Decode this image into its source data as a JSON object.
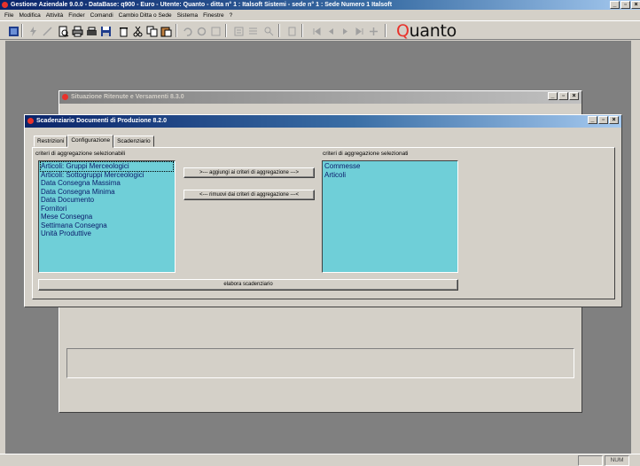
{
  "app": {
    "title": "Gestione Aziendale 9.0.0 - DataBase: q900 - Euro - Utente: Quanto - ditta n° 1 : Italsoft Sistemi - sede n° 1 : Sede Numero 1 Italsoft",
    "brand_prefix": "Q",
    "brand_rest": "uanto"
  },
  "menu": [
    "File",
    "Modifica",
    "Attività",
    "Finder",
    "Comandi",
    "Cambio Ditta o Sede",
    "Sistema",
    "Finestre",
    "?"
  ],
  "back_window": {
    "title": "Situazione Ritenute e Versamenti 8.3.0"
  },
  "main_window": {
    "title": "Scadenziario Documenti di Produzione 8.2.0",
    "tabs": [
      "Restrizioni",
      "Configurazione",
      "Scadenziario"
    ],
    "active_tab": "Configurazione",
    "available_label": "criteri di aggregazione selezionabili",
    "selected_label": "criteri di aggregazione selezionati",
    "available": [
      "Articoli: Gruppi Merceologici",
      "Articoli: Sottogruppi Merceologici",
      "Data Consegna Massima",
      "Data Consegna Minima",
      "Data Documento",
      "Fornitori",
      "Mese Consegna",
      "Settimana Consegna",
      "Unità Produttive"
    ],
    "selected": [
      "Commesse",
      "Articoli"
    ],
    "add_button": ">--- aggiungi ai criteri di aggregazione --->",
    "remove_button": "<--- rimuovi dai criteri di aggregazione ---<",
    "process_button": "elabora scadenziario"
  },
  "status": {
    "num": "NUM"
  }
}
